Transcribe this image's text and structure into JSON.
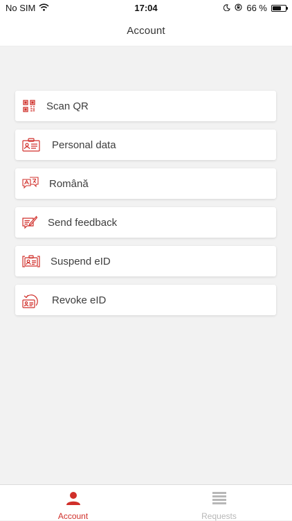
{
  "status_bar": {
    "carrier": "No SIM",
    "time": "17:04",
    "battery_percent": "66 %",
    "battery_level": 0.66
  },
  "header": {
    "title": "Account"
  },
  "menu": {
    "items": [
      {
        "label": "Scan QR",
        "icon": "qr-code-icon"
      },
      {
        "label": "Personal data",
        "icon": "id-card-icon"
      },
      {
        "label": "Română",
        "icon": "language-icon"
      },
      {
        "label": "Send feedback",
        "icon": "feedback-icon"
      },
      {
        "label": "Suspend eID",
        "icon": "suspend-id-icon"
      },
      {
        "label": "Revoke eID",
        "icon": "revoke-id-icon"
      }
    ]
  },
  "tab_bar": {
    "tabs": [
      {
        "label": "Account",
        "icon": "person-icon",
        "active": true
      },
      {
        "label": "Requests",
        "icon": "list-icon",
        "active": false
      }
    ]
  },
  "colors": {
    "accent": "#d02f2a",
    "inactive": "#b7b7b7",
    "background": "#f2f2f2"
  }
}
